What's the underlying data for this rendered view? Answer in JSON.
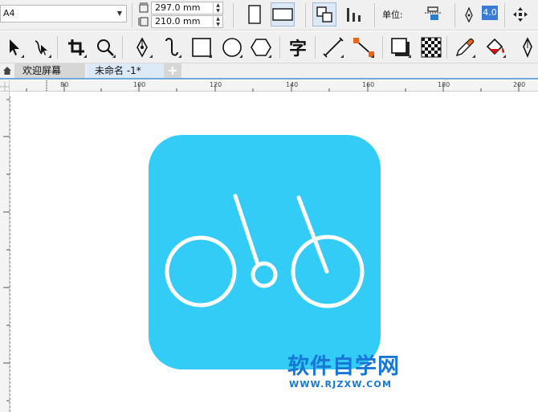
{
  "property_bar": {
    "page_size": "A4",
    "width_value": "297.0 mm",
    "height_value": "210.0 mm",
    "unit_label": "单位:",
    "outline_width": "4.0"
  },
  "tabs": [
    {
      "label": "欢迎屏幕"
    },
    {
      "label": "未命名 -1*"
    }
  ],
  "tab_add_label": "+",
  "toolbox": {
    "text_tool_glyph": "字"
  },
  "ruler": {
    "h_labels": [
      "80",
      "100",
      "120",
      "140",
      "160",
      "180",
      "200"
    ]
  },
  "canvas": {
    "icon_background": "#33ccf7",
    "icon_foreground": "#ffffff"
  },
  "watermark": {
    "title": "软件自学网",
    "url": "WWW.RJZXW.COM",
    "color": "#1677d6"
  }
}
